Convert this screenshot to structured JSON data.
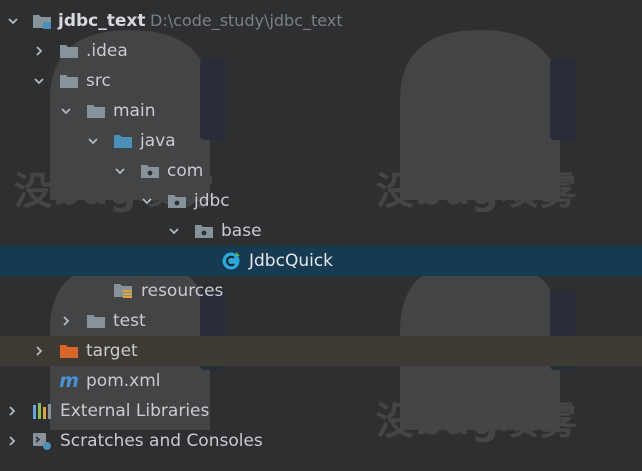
{
  "watermark": {
    "text": "没bug喷雾"
  },
  "project_tree": {
    "root": {
      "label": "jdbc_text",
      "path": "D:\\code_study\\jdbc_text"
    },
    "idea": {
      "label": ".idea"
    },
    "src": {
      "label": "src"
    },
    "main": {
      "label": "main"
    },
    "java": {
      "label": "java"
    },
    "com": {
      "label": "com"
    },
    "jdbc": {
      "label": "jdbc"
    },
    "base": {
      "label": "base"
    },
    "jdbcquick": {
      "label": "JdbcQuick"
    },
    "resources": {
      "label": "resources"
    },
    "test": {
      "label": "test"
    },
    "target": {
      "label": "target"
    },
    "pom": {
      "label": "pom.xml",
      "icon_glyph": "m"
    },
    "external_libraries": {
      "label": "External Libraries"
    },
    "scratches": {
      "label": "Scratches and Consoles"
    }
  },
  "colors": {
    "background": "#2d2f31",
    "selection": "#163a52",
    "excluded_row": "#3d3a33",
    "folder": "#87939a",
    "source_folder": "#4a90b8",
    "target_folder": "#d9652a",
    "class_icon": "#2aa7d6"
  }
}
